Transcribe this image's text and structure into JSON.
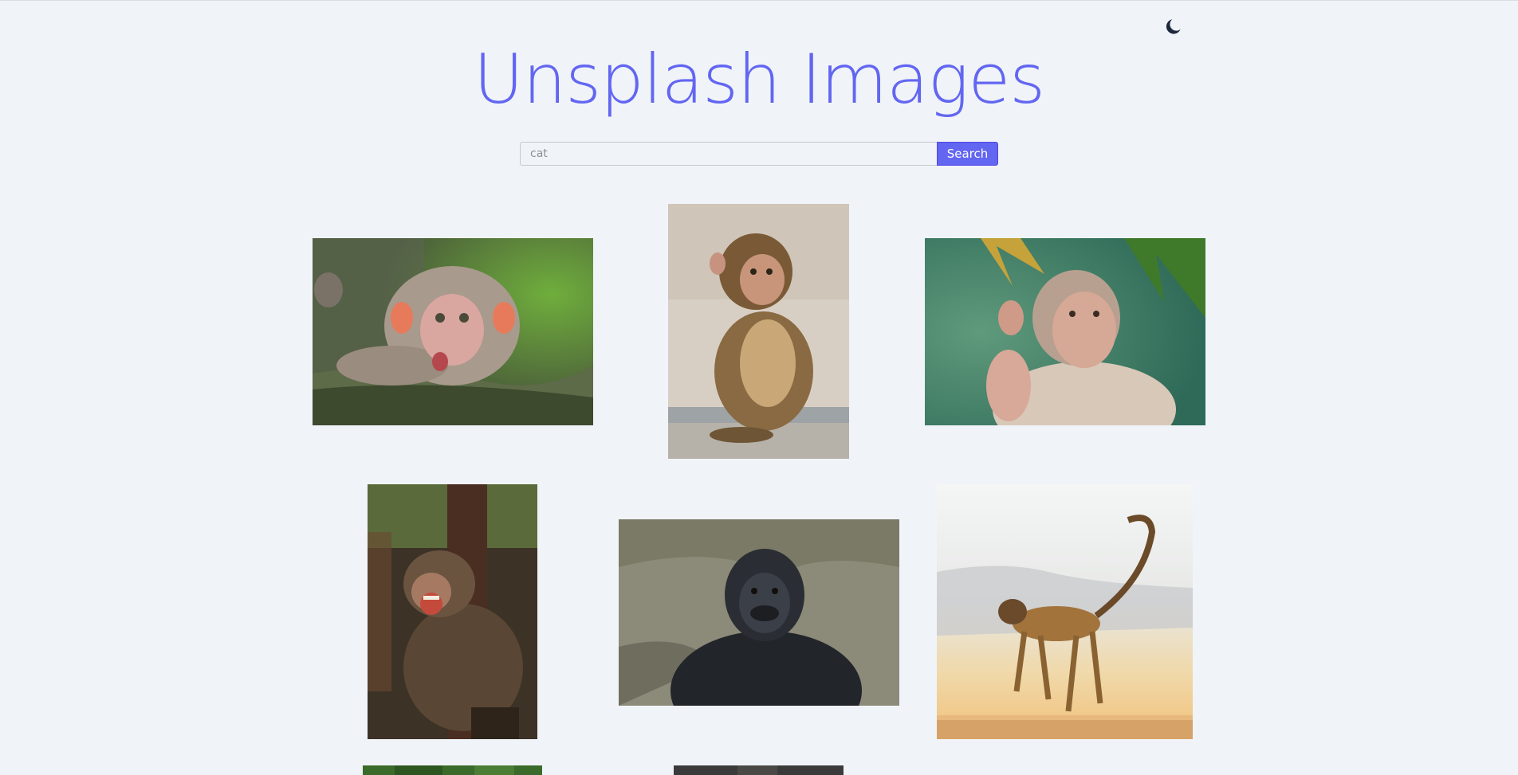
{
  "header": {
    "title": "Unsplash Images",
    "theme_toggle_icon": "moon-icon"
  },
  "search": {
    "placeholder": "cat",
    "value": "",
    "button_label": "Search"
  },
  "colors": {
    "accent": "#6366f1",
    "background": "#f0f4f8",
    "icon": "#1e293b"
  },
  "gallery": {
    "images": [
      {
        "alt": "Baby macaque on branch"
      },
      {
        "alt": "Young monkey sitting"
      },
      {
        "alt": "Monkey waving hand"
      },
      {
        "alt": "Laughing monkey"
      },
      {
        "alt": "Gorilla portrait"
      },
      {
        "alt": "Monkey walking on wall"
      },
      {
        "alt": "Partially visible photo"
      },
      {
        "alt": "Partially visible photo"
      }
    ]
  }
}
